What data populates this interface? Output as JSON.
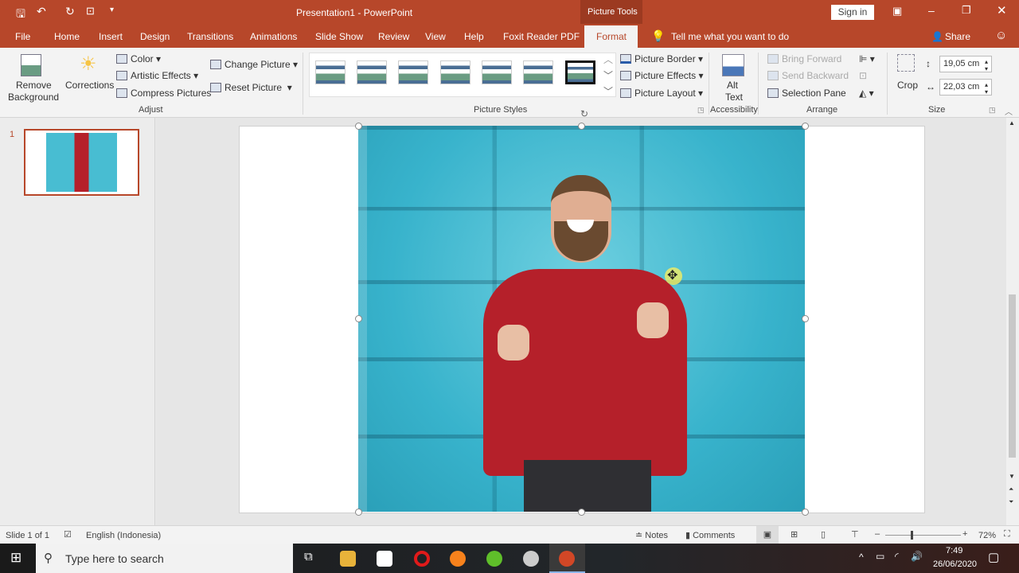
{
  "title": {
    "app_title": "Presentation1  -  PowerPoint",
    "context": "Picture Tools",
    "sign_in": "Sign in"
  },
  "tabs": [
    {
      "label": "File"
    },
    {
      "label": "Home"
    },
    {
      "label": "Insert"
    },
    {
      "label": "Design"
    },
    {
      "label": "Transitions"
    },
    {
      "label": "Animations"
    },
    {
      "label": "Slide Show"
    },
    {
      "label": "Review"
    },
    {
      "label": "View"
    },
    {
      "label": "Help"
    },
    {
      "label": "Foxit Reader PDF"
    },
    {
      "label": "Format"
    }
  ],
  "tell_me": "Tell me what you want to do",
  "share": "Share",
  "ribbon": {
    "adjust": {
      "remove_bg_1": "Remove",
      "remove_bg_2": "Background",
      "corrections": "Corrections",
      "color": "Color",
      "artistic": "Artistic Effects",
      "compress": "Compress Pictures",
      "change": "Change Picture",
      "reset": "Reset Picture",
      "group": "Adjust"
    },
    "styles": {
      "border": "Picture Border",
      "effects": "Picture Effects",
      "layout": "Picture Layout",
      "group": "Picture Styles"
    },
    "accessibility": {
      "alt1": "Alt",
      "alt2": "Text",
      "group": "Accessibility"
    },
    "arrange": {
      "forward": "Bring Forward",
      "backward": "Send Backward",
      "selection": "Selection Pane",
      "group": "Arrange"
    },
    "size": {
      "crop": "Crop",
      "height": "19,05 cm",
      "width": "22,03 cm",
      "group": "Size"
    }
  },
  "thumbs": {
    "number": "1"
  },
  "status": {
    "slide": "Slide 1 of 1",
    "language": "English (Indonesia)",
    "notes": "Notes",
    "comments": "Comments",
    "zoom": "72%",
    "zoom_percent": 72
  },
  "taskbar": {
    "search": "Type here to search",
    "time": "7:49",
    "date": "26/06/2020"
  },
  "colors": {
    "accent": "#b7472a"
  }
}
